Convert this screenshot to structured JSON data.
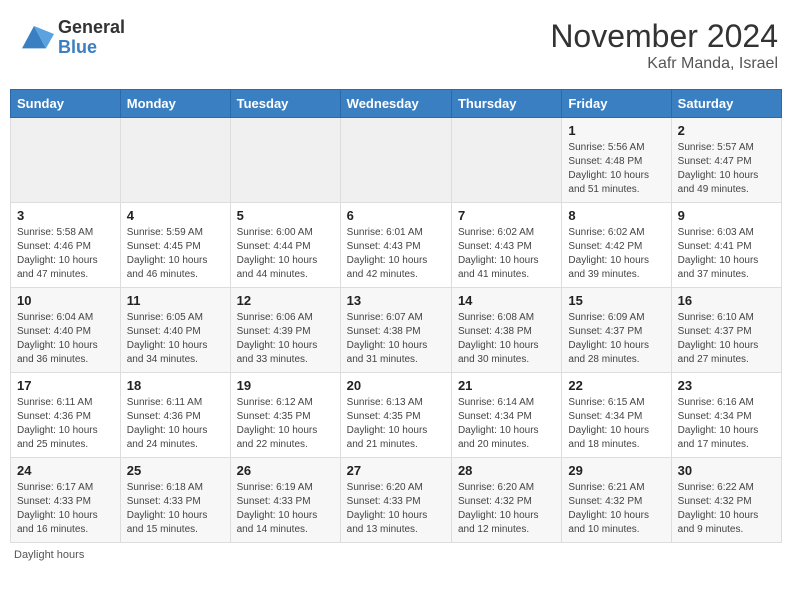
{
  "header": {
    "logo_general": "General",
    "logo_blue": "Blue",
    "month_title": "November 2024",
    "location": "Kafr Manda, Israel"
  },
  "days_of_week": [
    "Sunday",
    "Monday",
    "Tuesday",
    "Wednesday",
    "Thursday",
    "Friday",
    "Saturday"
  ],
  "footer": {
    "daylight_label": "Daylight hours"
  },
  "weeks": [
    [
      {
        "day": "",
        "info": ""
      },
      {
        "day": "",
        "info": ""
      },
      {
        "day": "",
        "info": ""
      },
      {
        "day": "",
        "info": ""
      },
      {
        "day": "",
        "info": ""
      },
      {
        "day": "1",
        "info": "Sunrise: 5:56 AM\nSunset: 4:48 PM\nDaylight: 10 hours\nand 51 minutes."
      },
      {
        "day": "2",
        "info": "Sunrise: 5:57 AM\nSunset: 4:47 PM\nDaylight: 10 hours\nand 49 minutes."
      }
    ],
    [
      {
        "day": "3",
        "info": "Sunrise: 5:58 AM\nSunset: 4:46 PM\nDaylight: 10 hours\nand 47 minutes."
      },
      {
        "day": "4",
        "info": "Sunrise: 5:59 AM\nSunset: 4:45 PM\nDaylight: 10 hours\nand 46 minutes."
      },
      {
        "day": "5",
        "info": "Sunrise: 6:00 AM\nSunset: 4:44 PM\nDaylight: 10 hours\nand 44 minutes."
      },
      {
        "day": "6",
        "info": "Sunrise: 6:01 AM\nSunset: 4:43 PM\nDaylight: 10 hours\nand 42 minutes."
      },
      {
        "day": "7",
        "info": "Sunrise: 6:02 AM\nSunset: 4:43 PM\nDaylight: 10 hours\nand 41 minutes."
      },
      {
        "day": "8",
        "info": "Sunrise: 6:02 AM\nSunset: 4:42 PM\nDaylight: 10 hours\nand 39 minutes."
      },
      {
        "day": "9",
        "info": "Sunrise: 6:03 AM\nSunset: 4:41 PM\nDaylight: 10 hours\nand 37 minutes."
      }
    ],
    [
      {
        "day": "10",
        "info": "Sunrise: 6:04 AM\nSunset: 4:40 PM\nDaylight: 10 hours\nand 36 minutes."
      },
      {
        "day": "11",
        "info": "Sunrise: 6:05 AM\nSunset: 4:40 PM\nDaylight: 10 hours\nand 34 minutes."
      },
      {
        "day": "12",
        "info": "Sunrise: 6:06 AM\nSunset: 4:39 PM\nDaylight: 10 hours\nand 33 minutes."
      },
      {
        "day": "13",
        "info": "Sunrise: 6:07 AM\nSunset: 4:38 PM\nDaylight: 10 hours\nand 31 minutes."
      },
      {
        "day": "14",
        "info": "Sunrise: 6:08 AM\nSunset: 4:38 PM\nDaylight: 10 hours\nand 30 minutes."
      },
      {
        "day": "15",
        "info": "Sunrise: 6:09 AM\nSunset: 4:37 PM\nDaylight: 10 hours\nand 28 minutes."
      },
      {
        "day": "16",
        "info": "Sunrise: 6:10 AM\nSunset: 4:37 PM\nDaylight: 10 hours\nand 27 minutes."
      }
    ],
    [
      {
        "day": "17",
        "info": "Sunrise: 6:11 AM\nSunset: 4:36 PM\nDaylight: 10 hours\nand 25 minutes."
      },
      {
        "day": "18",
        "info": "Sunrise: 6:11 AM\nSunset: 4:36 PM\nDaylight: 10 hours\nand 24 minutes."
      },
      {
        "day": "19",
        "info": "Sunrise: 6:12 AM\nSunset: 4:35 PM\nDaylight: 10 hours\nand 22 minutes."
      },
      {
        "day": "20",
        "info": "Sunrise: 6:13 AM\nSunset: 4:35 PM\nDaylight: 10 hours\nand 21 minutes."
      },
      {
        "day": "21",
        "info": "Sunrise: 6:14 AM\nSunset: 4:34 PM\nDaylight: 10 hours\nand 20 minutes."
      },
      {
        "day": "22",
        "info": "Sunrise: 6:15 AM\nSunset: 4:34 PM\nDaylight: 10 hours\nand 18 minutes."
      },
      {
        "day": "23",
        "info": "Sunrise: 6:16 AM\nSunset: 4:34 PM\nDaylight: 10 hours\nand 17 minutes."
      }
    ],
    [
      {
        "day": "24",
        "info": "Sunrise: 6:17 AM\nSunset: 4:33 PM\nDaylight: 10 hours\nand 16 minutes."
      },
      {
        "day": "25",
        "info": "Sunrise: 6:18 AM\nSunset: 4:33 PM\nDaylight: 10 hours\nand 15 minutes."
      },
      {
        "day": "26",
        "info": "Sunrise: 6:19 AM\nSunset: 4:33 PM\nDaylight: 10 hours\nand 14 minutes."
      },
      {
        "day": "27",
        "info": "Sunrise: 6:20 AM\nSunset: 4:33 PM\nDaylight: 10 hours\nand 13 minutes."
      },
      {
        "day": "28",
        "info": "Sunrise: 6:20 AM\nSunset: 4:32 PM\nDaylight: 10 hours\nand 12 minutes."
      },
      {
        "day": "29",
        "info": "Sunrise: 6:21 AM\nSunset: 4:32 PM\nDaylight: 10 hours\nand 10 minutes."
      },
      {
        "day": "30",
        "info": "Sunrise: 6:22 AM\nSunset: 4:32 PM\nDaylight: 10 hours\nand 9 minutes."
      }
    ]
  ]
}
